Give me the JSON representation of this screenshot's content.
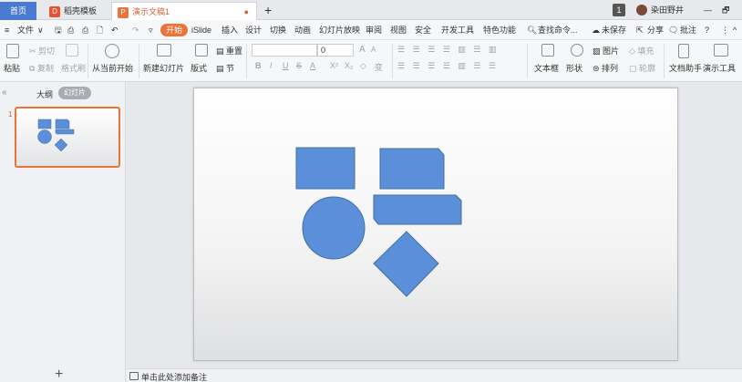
{
  "tabs": {
    "home": "首页",
    "docer": "稻壳模板",
    "active": "演示文稿1",
    "modified_dot": "●",
    "add": "+"
  },
  "titlebar_right": {
    "badge": "1",
    "user": "染田野井",
    "minimize": "—",
    "restore": "🗗"
  },
  "menu": {
    "file": "文件",
    "start": "开始",
    "items": [
      "iSlide",
      "插入",
      "设计",
      "切换",
      "动画",
      "幻灯片放映",
      "审阅",
      "视图",
      "安全",
      "开发工具",
      "特色功能"
    ],
    "search": "查找命令...",
    "unsaved": "未保存",
    "share": "分享",
    "comment": "批注",
    "help": "?",
    "more": "⋮",
    "collapse": "^"
  },
  "ribbon": {
    "paste": "粘贴",
    "cut": "剪切",
    "copy": "复制",
    "format_painter": "格式刷",
    "from_current": "从当前开始",
    "new_slide": "新建幻灯片",
    "layout": "版式",
    "section": "节",
    "reset": "重置",
    "font_size": "0",
    "textbox": "文本框",
    "shape": "形状",
    "picture": "图片",
    "fill": "填充",
    "arrange": "排列",
    "outline": "轮廓",
    "doc_assistant": "文档助手",
    "present_tools": "演示工具",
    "font_buttons": [
      "B",
      "I",
      "U",
      "S",
      "A",
      "X²",
      "X₂",
      "◇",
      "变"
    ],
    "grow_font": "A",
    "shrink_font": "A"
  },
  "left_panel": {
    "collapse": "«",
    "outline_tab": "大纲",
    "slides_tab": "幻灯片",
    "slide_number": "1",
    "add_slide": "+"
  },
  "notes": {
    "placeholder": "单击此处添加备注"
  },
  "colors": {
    "accent": "#e9743a",
    "shape_fill": "#5b8fd9",
    "shape_stroke": "#41719c",
    "home_tab": "#4a7bd0"
  }
}
